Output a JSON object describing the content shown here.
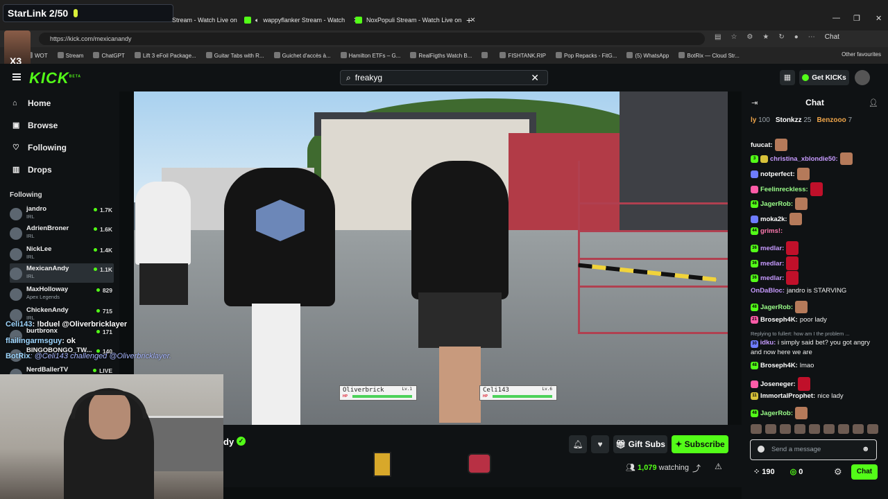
{
  "overlay_title": "StarLink 2/50",
  "overlay_x13": "X3",
  "browser": {
    "tabs": [
      {
        "label": "Stream - Watch Live on"
      },
      {
        "label": "wappyflanker Stream - Watch"
      },
      {
        "label": "NoxPopuli Stream - Watch Live on"
      }
    ],
    "new_tab": "+",
    "url": "https://kick.com/mexicanandy",
    "bookmarks": [
      "WOT",
      "Stream",
      "ChatGPT",
      "Lift 3 eFoil Package...",
      "Guitar Tabs with R...",
      "Guichet d'accès à...",
      "Hamilton ETFs – G...",
      "RealFigths Watch B...",
      "",
      "FISHTANK.RIP",
      "Pop Repacks - FitG...",
      "(5) WhatsApp",
      "BotRix — Cloud Str..."
    ],
    "other_fav": "Other favourites",
    "profile_label": "Chat"
  },
  "kick": {
    "logo": "KICK",
    "logo_badge": "BETA",
    "search_value": "freakyg",
    "get_kicks": "Get KICKs"
  },
  "sidebar": {
    "nav": [
      "Home",
      "Browse",
      "Following",
      "Drops"
    ],
    "following_header": "Following",
    "following": [
      {
        "name": "jandro",
        "category": "IRL",
        "viewers": "1.7K"
      },
      {
        "name": "AdrienBroner",
        "category": "IRL",
        "viewers": "1.6K"
      },
      {
        "name": "NickLee",
        "category": "IRL",
        "viewers": "1.4K"
      },
      {
        "name": "MexicanAndy",
        "category": "IRL",
        "viewers": "1.1K"
      },
      {
        "name": "MaxHolloway",
        "category": "Apex Legends",
        "viewers": "829"
      },
      {
        "name": "ChickenAndy",
        "category": "IRL",
        "viewers": "715"
      },
      {
        "name": "burtbronx",
        "category": "",
        "viewers": "171"
      },
      {
        "name": "BINGOBONGO_TW...",
        "category": "",
        "viewers": "140"
      },
      {
        "name": "NerdBallerTV",
        "category": "",
        "viewers": "LIVE"
      }
    ]
  },
  "overlay_chat": [
    {
      "user": "Celi143",
      "text": ": !bduel @Oliverbricklayer"
    },
    {
      "user": "flailingarmsguy",
      "text": ": ok"
    },
    {
      "user": "BotRix",
      "text": ": @Celi143 challenged @Oliverbricklayer."
    }
  ],
  "battle": {
    "left": {
      "name": "Oliverbrick",
      "level": "Lv.1",
      "hp_label": "HP",
      "hp": 1.0
    },
    "right": {
      "name": "Celi143",
      "level": "Lv.6",
      "hp_label": "HP",
      "hp": 1.0
    }
  },
  "channel": {
    "name_partial": "dy",
    "gift_subs": "Gift Subs",
    "subscribe": "Subscribe",
    "watching_count": "1,079",
    "watching_label": "watching"
  },
  "chat": {
    "title": "Chat",
    "leaderboard": [
      {
        "name": "ly",
        "value": "100"
      },
      {
        "name": "Stonkzz",
        "value": "25"
      },
      {
        "name": "Benzooo",
        "value": "7"
      }
    ],
    "messages": [
      {
        "user": "fuucat:",
        "text": "",
        "color": "#ffffff"
      },
      {
        "user": "christina_xblondie50:",
        "text": "",
        "color": "#c79bff"
      },
      {
        "user": "notperfect:",
        "text": "",
        "color": "#ffffff"
      },
      {
        "user": "Feelinreckless:",
        "text": "",
        "color": "#9bff8a"
      },
      {
        "user": "JagerRob:",
        "text": "",
        "color": "#9bff8a"
      },
      {
        "user": "moka2k:",
        "text": "",
        "color": "#ffffff"
      },
      {
        "user": "grims!:",
        "text": "",
        "color": "#ff7ab0"
      },
      {
        "user": "medlar:",
        "text": "",
        "color": "#c79bff"
      },
      {
        "user": "medlar:",
        "text": "",
        "color": "#c79bff"
      },
      {
        "user": "medlar:",
        "text": "",
        "color": "#c79bff"
      },
      {
        "user": "OnDaBloc:",
        "text": "jandro is STARVING",
        "color": "#c79bff"
      },
      {
        "user": "JagerRob:",
        "text": "",
        "color": "#9bff8a"
      },
      {
        "user": "Broseph4K:",
        "text": "poor lady",
        "color": "#ffffff"
      },
      {
        "user": "idku:",
        "text": "i simply said bet? you got angry and now here we are",
        "color": "#c79bff"
      },
      {
        "user": "Broseph4K:",
        "text": "lmao",
        "color": "#ffffff"
      },
      {
        "user": "Joseneger:",
        "text": "",
        "color": "#ffffff"
      },
      {
        "user": "ImmortalProphet:",
        "text": "nice lady",
        "color": "#ffffff"
      },
      {
        "user": "JagerRob:",
        "text": "",
        "color": "#9bff8a"
      }
    ],
    "reply_text": "Replying to fullert: how am I the problem ...",
    "input_placeholder": "Send a message",
    "points": "190",
    "kicks": "0",
    "send_label": "Chat"
  }
}
